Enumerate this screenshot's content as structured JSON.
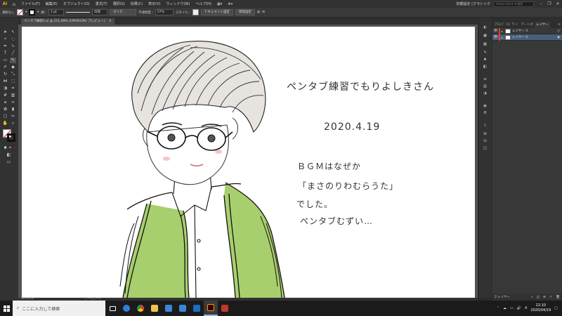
{
  "app": {
    "logo": "Ai",
    "home_icon": "home-icon"
  },
  "menu": {
    "items": [
      "ファイル(F)",
      "編集(E)",
      "オブジェクト(O)",
      "書式(T)",
      "選択(S)",
      "効果(C)",
      "表示(V)",
      "ウィンドウ(W)",
      "ヘルプ(H)"
    ],
    "workspace": "初期設定 (クラシック",
    "search_placeholder": "Adobe Stock を検索"
  },
  "control_bar": {
    "selection_label": "選択なし",
    "stroke_label": "線 :",
    "stroke_weight": "1 pt",
    "stroke_style": "均等",
    "brush": "カリグ...",
    "opacity_label": "不透明度 :",
    "opacity_value": "57%",
    "style_label": "スタイル :",
    "doc_setup_button": "ドキュメント設定",
    "prefs_button": "環境設定"
  },
  "document": {
    "tab_title": "ペンタブ練習1.ai @ 211.49% (CMYK/GPU プレビュー)"
  },
  "artwork_notes": {
    "line1": "ペンタブ練習でもりよしきさん",
    "line2": "2020.4.19",
    "line3": "ＢＧＭはなぜか",
    "line4": "「まさのりわむらうた」",
    "line5": "でした。",
    "line6": "ペンタブむずい…"
  },
  "status": {
    "zoom": "211.49%",
    "artboard_label": "アートボード"
  },
  "layers_panel": {
    "tabs": [
      "プロパ",
      "CC ライ",
      "アートボ",
      "レイヤー"
    ],
    "active_tab": "レイヤー",
    "layers": [
      {
        "name": "レイヤー 3",
        "color": "#e8402c",
        "selected": false
      },
      {
        "name": "レイヤー 3",
        "color": "#e8402c",
        "selected": true
      }
    ],
    "footer_label": "2 レイヤー"
  },
  "taskbar": {
    "search_placeholder": "ここに入力して検索",
    "apps": [
      {
        "name": "task-view",
        "color": "#ffffff"
      },
      {
        "name": "edge",
        "color": "#2f7fd8"
      },
      {
        "name": "chrome",
        "color": "#e0a62c"
      },
      {
        "name": "explorer",
        "color": "#f0c44c"
      },
      {
        "name": "mail",
        "color": "#3a86d8"
      },
      {
        "name": "store",
        "color": "#3a86d8"
      },
      {
        "name": "outlook",
        "color": "#1b6ec2"
      },
      {
        "name": "illustrator",
        "color": "#ff9a00"
      },
      {
        "name": "media",
        "color": "#c0392b"
      }
    ],
    "time": "22:10",
    "date": "2020/04/19"
  },
  "colors": {
    "accent_orange": "#ff9a00",
    "jacket_green": "#a8cf6d",
    "selection_blue": "#46607a"
  }
}
